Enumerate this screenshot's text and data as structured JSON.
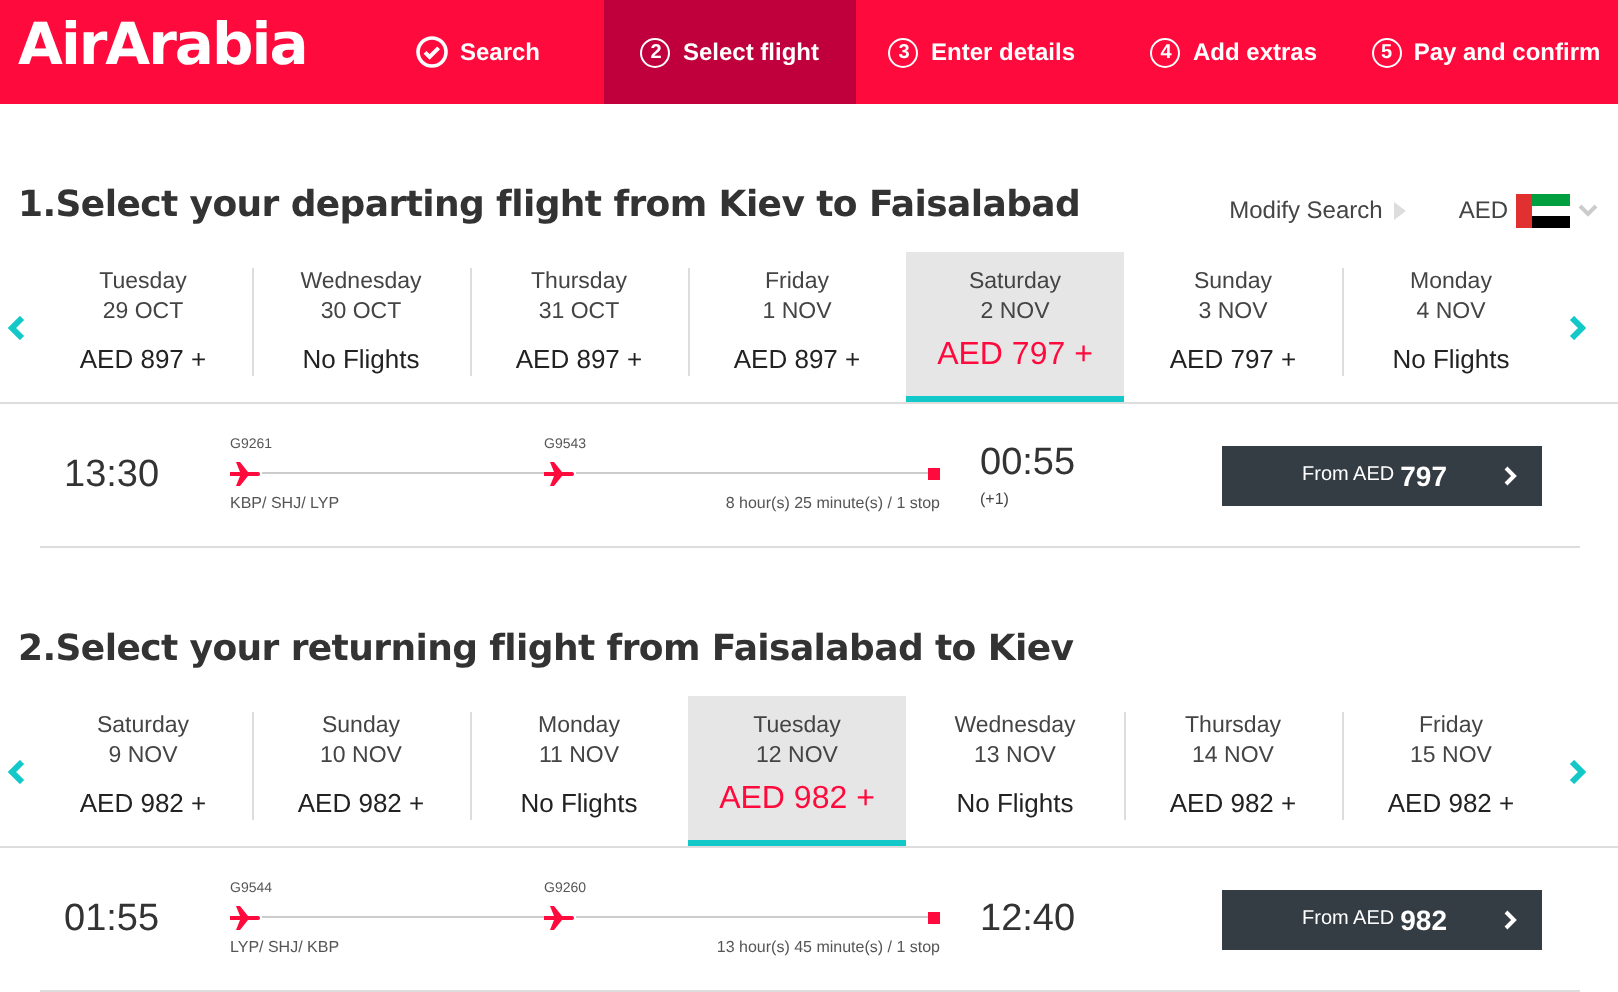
{
  "header": {
    "logo": "AirArabia",
    "steps": [
      {
        "kind": "done",
        "label": "Search",
        "selected": false
      },
      {
        "kind": "number",
        "number": "2",
        "label": "Select flight",
        "selected": true
      },
      {
        "kind": "number",
        "number": "3",
        "label": "Enter details",
        "selected": false
      },
      {
        "kind": "number",
        "number": "4",
        "label": "Add extras",
        "selected": false
      },
      {
        "kind": "number",
        "number": "5",
        "label": "Pay and confirm",
        "selected": false
      }
    ]
  },
  "sections": [
    {
      "number": "1.",
      "title": "Select your departing flight from Kiev to Faisalabad",
      "modify": "Modify Search",
      "currency": "AED",
      "dates": [
        {
          "day": "Tuesday",
          "date": "29 OCT",
          "price": "AED 897 +",
          "selected": false
        },
        {
          "day": "Wednesday",
          "date": "30 OCT",
          "price": "No Flights",
          "selected": false
        },
        {
          "day": "Thursday",
          "date": "31 OCT",
          "price": "AED 897 +",
          "selected": false
        },
        {
          "day": "Friday",
          "date": "1 NOV",
          "price": "AED 897 +",
          "selected": false
        },
        {
          "day": "Saturday",
          "date": "2 NOV",
          "price": "AED 797 +",
          "selected": true
        },
        {
          "day": "Sunday",
          "date": "3 NOV",
          "price": "AED 797 +",
          "selected": false
        },
        {
          "day": "Monday",
          "date": "4 NOV",
          "price": "No Flights",
          "selected": false
        }
      ],
      "flight": {
        "depart": "13:30",
        "arrive": "00:55",
        "day_offset": "(+1)",
        "flight_numbers": [
          "G9261",
          "G9543"
        ],
        "route": "KBP/ SHJ/ LYP",
        "duration": "8 hour(s) 25 minute(s) / 1 stop",
        "button_prefix": "From AED",
        "button_price": "797"
      }
    },
    {
      "number": "2.",
      "title": "Select your returning flight from Faisalabad to Kiev",
      "dates": [
        {
          "day": "Saturday",
          "date": "9 NOV",
          "price": "AED 982 +",
          "selected": false
        },
        {
          "day": "Sunday",
          "date": "10 NOV",
          "price": "AED 982 +",
          "selected": false
        },
        {
          "day": "Monday",
          "date": "11 NOV",
          "price": "No Flights",
          "selected": false
        },
        {
          "day": "Tuesday",
          "date": "12 NOV",
          "price": "AED 982 +",
          "selected": true
        },
        {
          "day": "Wednesday",
          "date": "13 NOV",
          "price": "No Flights",
          "selected": false
        },
        {
          "day": "Thursday",
          "date": "14 NOV",
          "price": "AED 982 +",
          "selected": false
        },
        {
          "day": "Friday",
          "date": "15 NOV",
          "price": "AED 982 +",
          "selected": false
        }
      ],
      "flight": {
        "depart": "01:55",
        "arrive": "12:40",
        "flight_numbers": [
          "G9544",
          "G9260"
        ],
        "route": "LYP/ SHJ/ KBP",
        "duration": "13 hour(s) 45 minute(s) / 1 stop",
        "button_prefix": "From AED",
        "button_price": "982"
      }
    }
  ]
}
